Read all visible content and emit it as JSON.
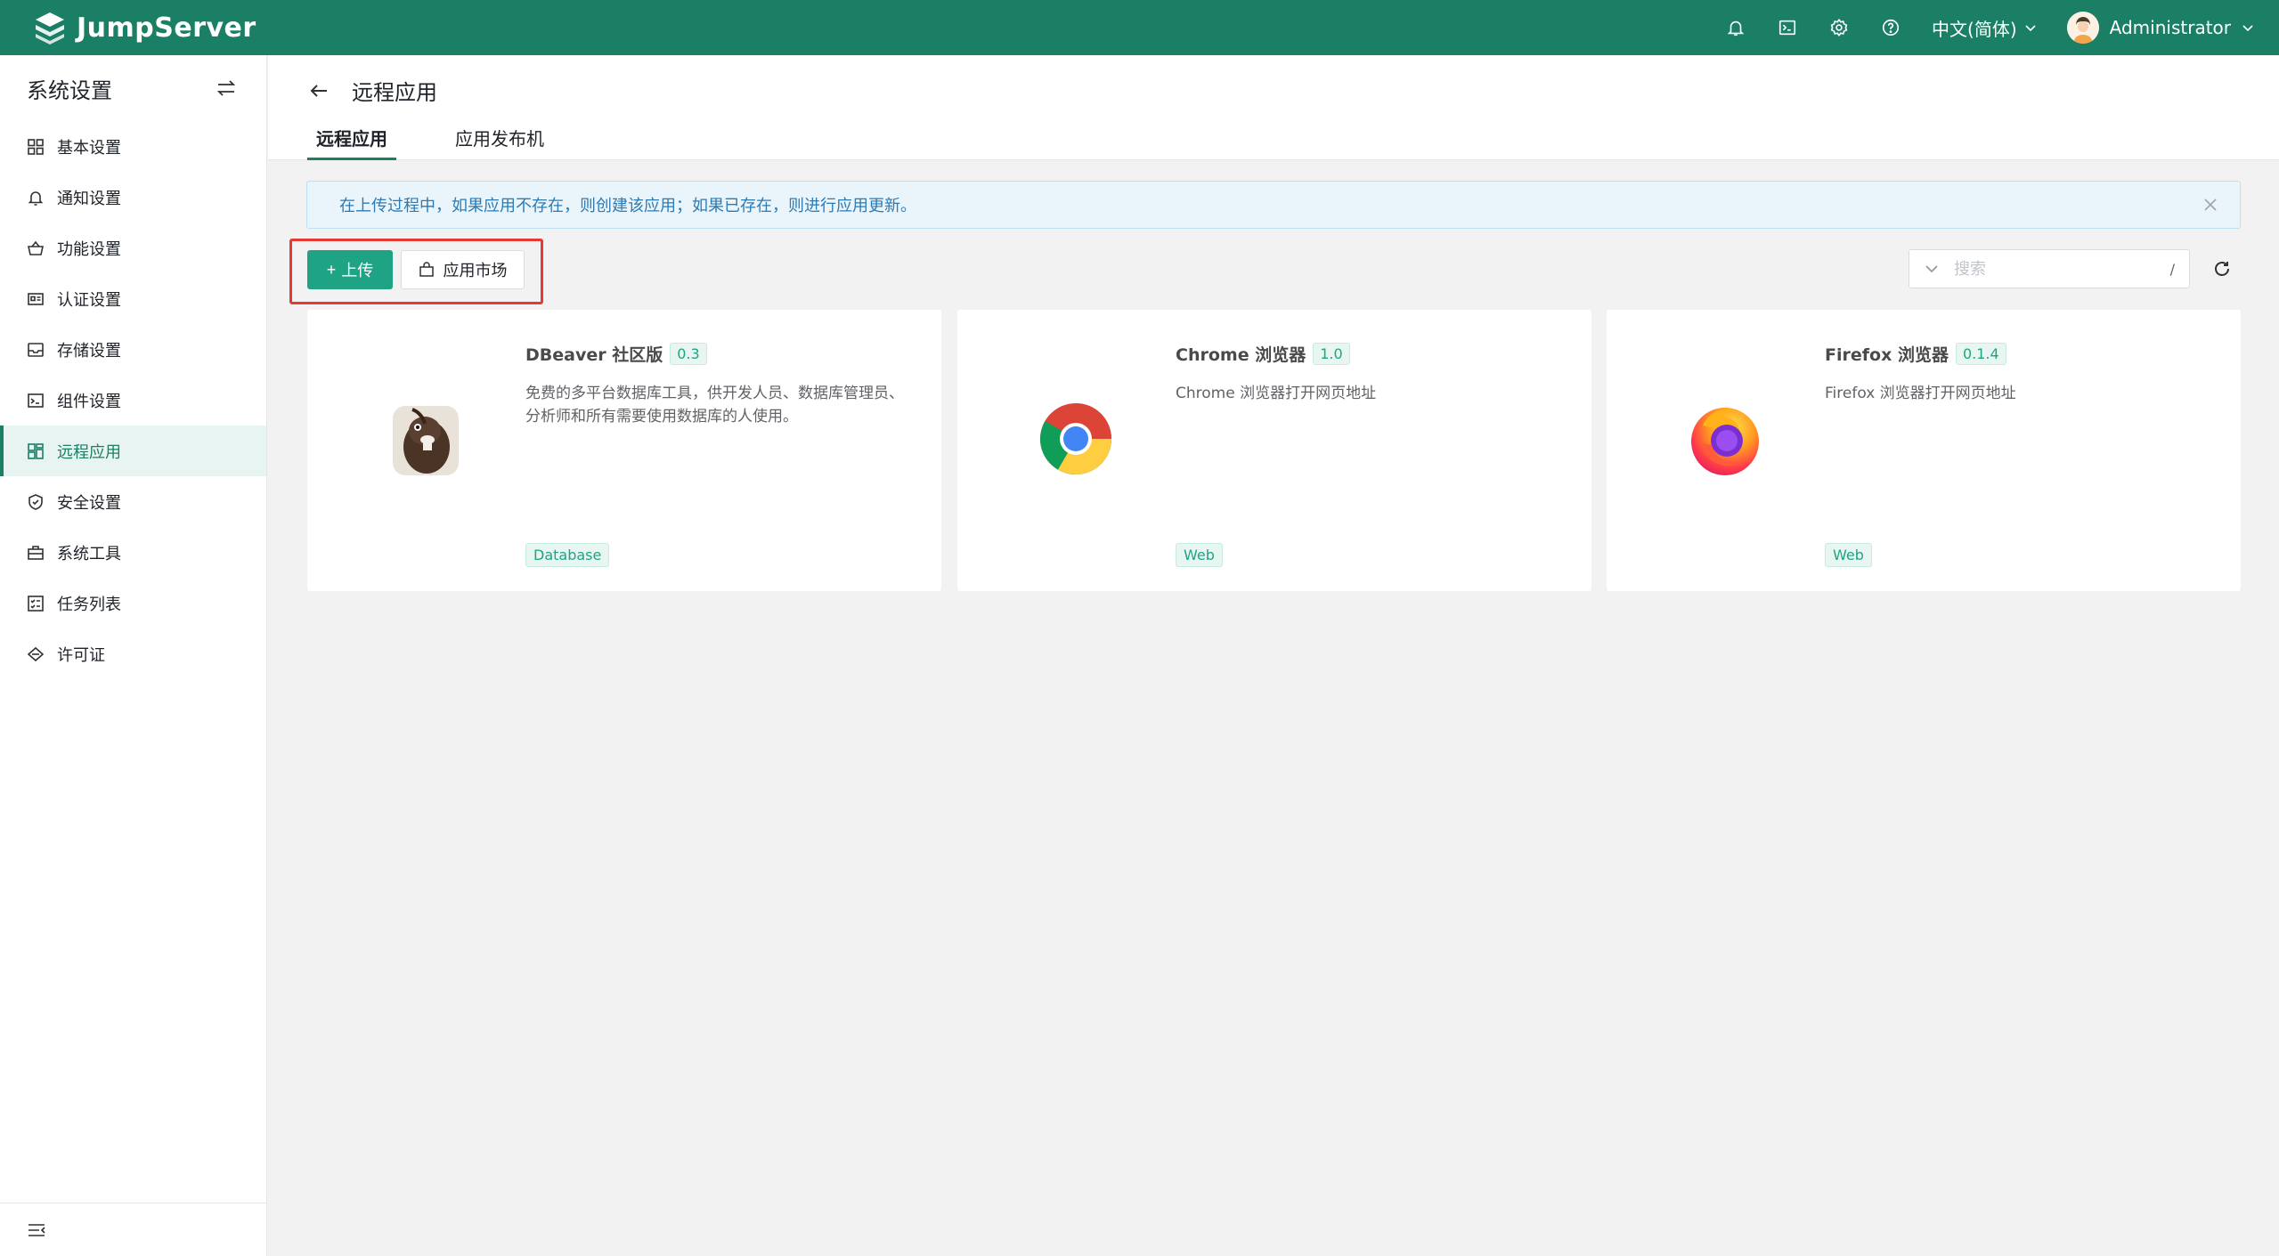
{
  "brand": {
    "name": "JumpServer"
  },
  "header": {
    "language": "中文(简体)",
    "user": "Administrator",
    "icons": [
      "bell-icon",
      "terminal-icon",
      "gear-icon",
      "help-icon"
    ]
  },
  "sidebar": {
    "title": "系统设置",
    "items": [
      {
        "label": "基本设置",
        "icon": "grid-icon"
      },
      {
        "label": "通知设置",
        "icon": "bell-icon"
      },
      {
        "label": "功能设置",
        "icon": "basket-icon"
      },
      {
        "label": "认证设置",
        "icon": "id-card-icon"
      },
      {
        "label": "存储设置",
        "icon": "inbox-icon"
      },
      {
        "label": "组件设置",
        "icon": "terminal-window-icon"
      },
      {
        "label": "远程应用",
        "icon": "apps-icon",
        "active": true
      },
      {
        "label": "安全设置",
        "icon": "shield-icon"
      },
      {
        "label": "系统工具",
        "icon": "toolbox-icon"
      },
      {
        "label": "任务列表",
        "icon": "tasklist-icon"
      },
      {
        "label": "许可证",
        "icon": "diamond-icon"
      }
    ]
  },
  "page": {
    "title": "远程应用",
    "tabs": [
      {
        "label": "远程应用",
        "active": true
      },
      {
        "label": "应用发布机",
        "active": false
      }
    ]
  },
  "alert": {
    "text": "在上传过程中，如果应用不存在，则创建该应用；如果已存在，则进行应用更新。"
  },
  "toolbar": {
    "upload_label": "上传",
    "market_label": "应用市场",
    "search_placeholder": "搜索",
    "search_shortcut": "/"
  },
  "cards": [
    {
      "name": "DBeaver 社区版",
      "version": "0.3",
      "description": "免费的多平台数据库工具，供开发人员、数据库管理员、分析师和所有需要使用数据库的人使用。",
      "tag": "Database",
      "icon": "dbeaver-logo"
    },
    {
      "name": "Chrome 浏览器",
      "version": "1.0",
      "description": "Chrome 浏览器打开网页地址",
      "tag": "Web",
      "icon": "chrome-logo"
    },
    {
      "name": "Firefox 浏览器",
      "version": "0.1.4",
      "description": "Firefox 浏览器打开网页地址",
      "tag": "Web",
      "icon": "firefox-logo"
    }
  ],
  "colors": {
    "header": "#1a7f64",
    "accent": "#1fa385",
    "highlight": "#e53935"
  }
}
